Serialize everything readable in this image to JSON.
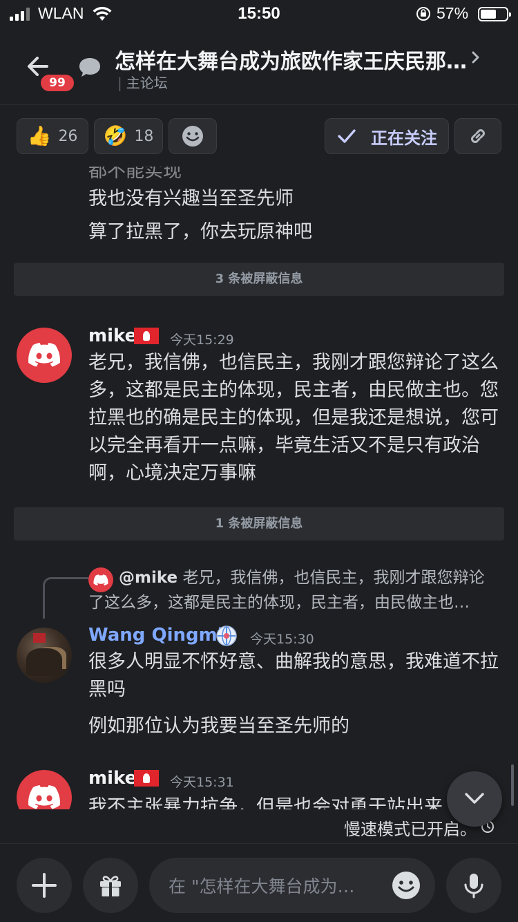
{
  "status": {
    "carrier": "WLAN",
    "time": "15:50",
    "battery": "57%"
  },
  "header": {
    "badge": "99",
    "title": "怎样在大舞台成为旅欧作家王庆民那…",
    "subtitle": "主论坛"
  },
  "reactions": {
    "thumbs": {
      "emoji": "👍",
      "count": "26"
    },
    "laugh": {
      "emoji": "🤣",
      "count": "18"
    },
    "follow_label": "正在关注"
  },
  "messages": {
    "top_line_1": "我也没有兴趣当至圣先师",
    "top_line_2": "算了拉黑了，你去玩原神吧",
    "blocked_1": "3 条被屏蔽信息",
    "mike_1": {
      "name": "mike",
      "time": "今天15:29",
      "body": "老兄，我信佛，也信民主，我刚才跟您辩论了这么多，这都是民主的体现，民主者，由民做主也。您拉黑也的确是民主的体现，但是我还是想说，您可以完全再看开一点嘛，毕竟生活又不是只有政治啊，心境决定万事嘛"
    },
    "blocked_2": "1 条被屏蔽信息",
    "reply": {
      "mention": "@mike",
      "text": "老兄，我信佛，也信民主，我刚才跟您辩论了这么多，这都是民主的体现，民主者，由民做主也…"
    },
    "wang": {
      "name": "Wang Qingmin",
      "time": "今天15:30",
      "body": "很多人明显不怀好意、曲解我的意思，我难道不拉黑吗",
      "line_2": "例如那位认为我要当至圣先师的"
    },
    "mike_2": {
      "name": "mike",
      "time": "今天15:31",
      "body": "我不主张暴力抗争，但是也会对勇于站出来"
    }
  },
  "slowmode": "慢速模式已开启。",
  "composer": {
    "placeholder": "在 \"怎样在大舞台成为…"
  }
}
